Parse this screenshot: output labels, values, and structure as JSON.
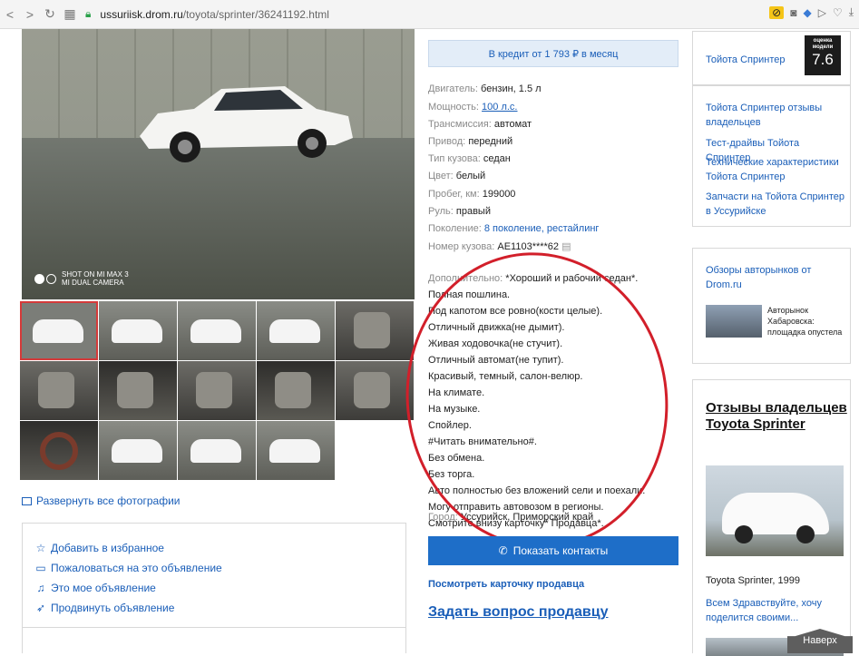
{
  "browser": {
    "url_host": "ussuriisk.drom.ru",
    "url_path": "/toyota/sprinter/36241192.html"
  },
  "gallery": {
    "camera_text_1": "SHOT ON MI MAX 3",
    "camera_text_2": "MI DUAL CAMERA",
    "expand_label": "Развернуть все фотографии"
  },
  "actions": {
    "favorite": "Добавить в избранное",
    "complain": "Пожаловаться на это объявление",
    "mine": "Это мое объявление",
    "promote": "Продвинуть объявление"
  },
  "credit": "В кредит от 1 793 ₽ в месяц",
  "specs": [
    {
      "k": "Двигатель:",
      "v": "бензин, 1.5 л"
    },
    {
      "k": "Мощность:",
      "v": "100 л.с."
    },
    {
      "k": "Трансмиссия:",
      "v": "автомат"
    },
    {
      "k": "Привод:",
      "v": "передний"
    },
    {
      "k": "Тип кузова:",
      "v": "седан"
    },
    {
      "k": "Цвет:",
      "v": "белый"
    },
    {
      "k": "Пробег, км:",
      "v": "199000"
    },
    {
      "k": "Руль:",
      "v": "правый"
    },
    {
      "k": "Поколение:",
      "v": "8 поколение, рестайлинг"
    },
    {
      "k": "Номер кузова:",
      "v": "AE1103****62"
    }
  ],
  "description": {
    "key": "Дополнительно:",
    "lines": [
      "*Хороший и рабочий седан*.",
      "Полная пошлина.",
      "Под капотом все ровно(кости целые).",
      "Отличный движка(не дымит).",
      "Живая ходовочка(не стучит).",
      "Отличный автомат(не тупит).",
      "Красивый, темный, салон-велюр.",
      "На климате.",
      "На музыке.",
      "Спойлер.",
      "#Читать внимательно#.",
      "Без обмена.",
      "Без торга.",
      "Авто полностью без вложений сели и поехали.",
      "Могу отправить автовозом в регионы.",
      "Смотрите внизу карточку* Продавца*."
    ]
  },
  "city": {
    "k": "Город:",
    "v": "Уссурийск, Приморский край"
  },
  "contacts_button": "Показать контакты",
  "seller_card": "Посмотреть карточку продавца",
  "ask_seller": "Задать вопрос продавцу",
  "sidebar": {
    "rating_title": "Тойота Спринтер",
    "rating_label_1": "оценка",
    "rating_label_2": "модели",
    "rating_value": "7.6",
    "links": [
      "Тойота Спринтер отзывы владельцев",
      "Тест-драйвы Тойота Спринтер",
      "Технические характеристики Тойота Спринтер",
      "Запчасти на Тойота Спринтер в Уссурийске"
    ],
    "market_review_link": "Обзоры авторынков от Drom.ru",
    "market_caption": "Авторынок Хабаровска: площадка опустела",
    "owners_title": "Отзывы владельцев Toyota Sprinter",
    "owners_model": "Toyota Sprinter, 1999",
    "owners_snippet": "Всем Здравствуйте, хочу поделится своими...",
    "to_top": "Наверх"
  }
}
